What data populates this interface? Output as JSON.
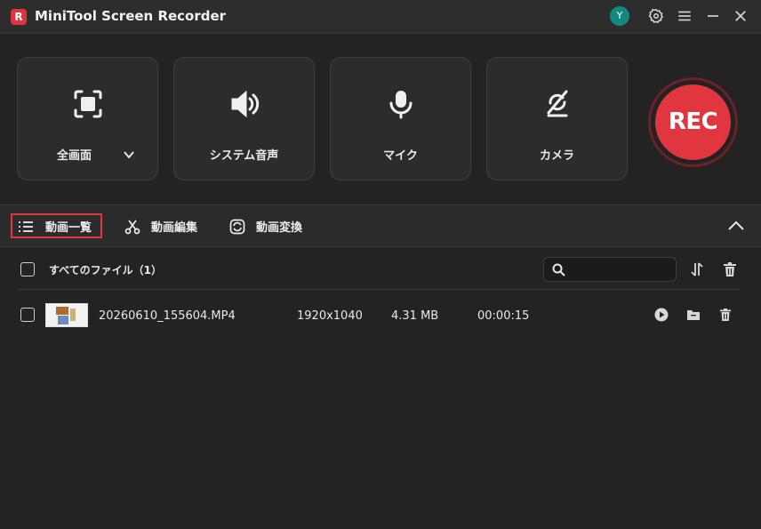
{
  "app": {
    "logo_letter": "R",
    "title": "MiniTool Screen Recorder",
    "avatar_letter": "Y"
  },
  "titlebar_icons": [
    "settings-icon",
    "menu-icon",
    "minimize-icon",
    "close-icon"
  ],
  "sources": [
    {
      "label": "全画面",
      "icon": "fullscreen-icon",
      "has_dropdown": true
    },
    {
      "label": "システム音声",
      "icon": "speaker-icon"
    },
    {
      "label": "マイク",
      "icon": "microphone-icon"
    },
    {
      "label": "カメラ",
      "icon": "camera-off-icon"
    }
  ],
  "rec_button": {
    "label": "REC",
    "color": "#e1353f"
  },
  "tabs": [
    {
      "label": "動画一覧",
      "icon": "list-icon",
      "active": true
    },
    {
      "label": "動画編集",
      "icon": "scissors-icon"
    },
    {
      "label": "動画変換",
      "icon": "convert-icon"
    }
  ],
  "list": {
    "header_label": "すべてのファイル（1）",
    "search_placeholder": "",
    "rows": [
      {
        "name": "20260610_155604.MP4",
        "resolution": "1920x1040",
        "size": "4.31 MB",
        "duration": "00:00:15"
      }
    ]
  },
  "colors": {
    "accent": "#e1353f",
    "background": "#232323",
    "avatar": "#118a7d"
  }
}
